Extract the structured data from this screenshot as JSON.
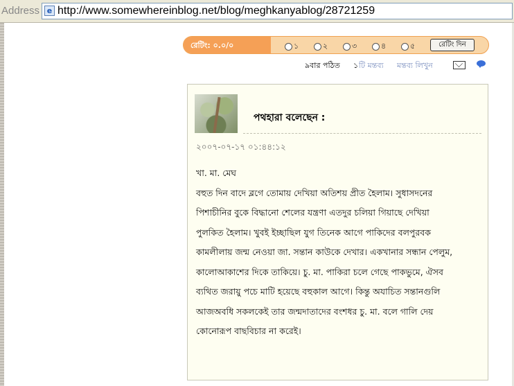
{
  "address_bar": {
    "label": "Address",
    "url": "http://www.somewhereinblog.net/blog/meghkanyablog/28721259"
  },
  "rating": {
    "label": "রেটিং: ০.০/০",
    "options": [
      "১",
      "২",
      "৩",
      "৪",
      "৫"
    ],
    "button": "রেটিং দিন"
  },
  "meta": {
    "read_count": "৯বার পঠিত",
    "comment_count_num": "১",
    "comment_count_text": "টি মন্তব্য",
    "write_comment": "মন্তব্য লিখুন",
    "icons": [
      "mail-icon",
      "chat-icon"
    ]
  },
  "comment": {
    "author": "পথহারা বলেছেন :",
    "timestamp": "২০০৭-০৭-১৭ ০১:৪৪:১২",
    "lines": [
      "খা. মা. মেঘ",
      "বহুত দিন বাদে ব্লগে তোমায় দেখিয়া অতিশয় প্রীত হৈলাম। সুধাসদনের",
      "পিশাচীনির বুকে বিদ্ধানো শেলের যন্ত্রণা এতদুর চলিয়া গিয়াছে দেখিয়া",
      "পুলকিত হৈলাম। খুবই ইচ্ছাছিল যুগ তিনেক আগে পাকিদের বলপুরবক",
      "কামলীলায় জন্ম নেওয়া জা. সন্তান কাউকে দেখার। একখানার সন্ধান পেলুম,",
      "কালোআকাশের দিকে তাকিয়ে। চু. মা. পাকিরা চলে গেছে পাকভুমে, ঐসব",
      "ব্যথিত জরায়ু পচে মাটি হয়েছে বহুকাল আগে। কিন্তু অযাচিত সন্তানগুলি",
      "আজঅবধি সকলকেই তার জন্মদাতাদের বংশধর চু. মা. বলে গালি দেয়",
      "কোনোরূপ বাছবিচার না করেই।"
    ]
  },
  "colors": {
    "rating_pill": "#f5a056",
    "rating_bar": "#f9d6a7",
    "card_bg": "#fefef1",
    "link_blue": "#3a6fd8"
  }
}
